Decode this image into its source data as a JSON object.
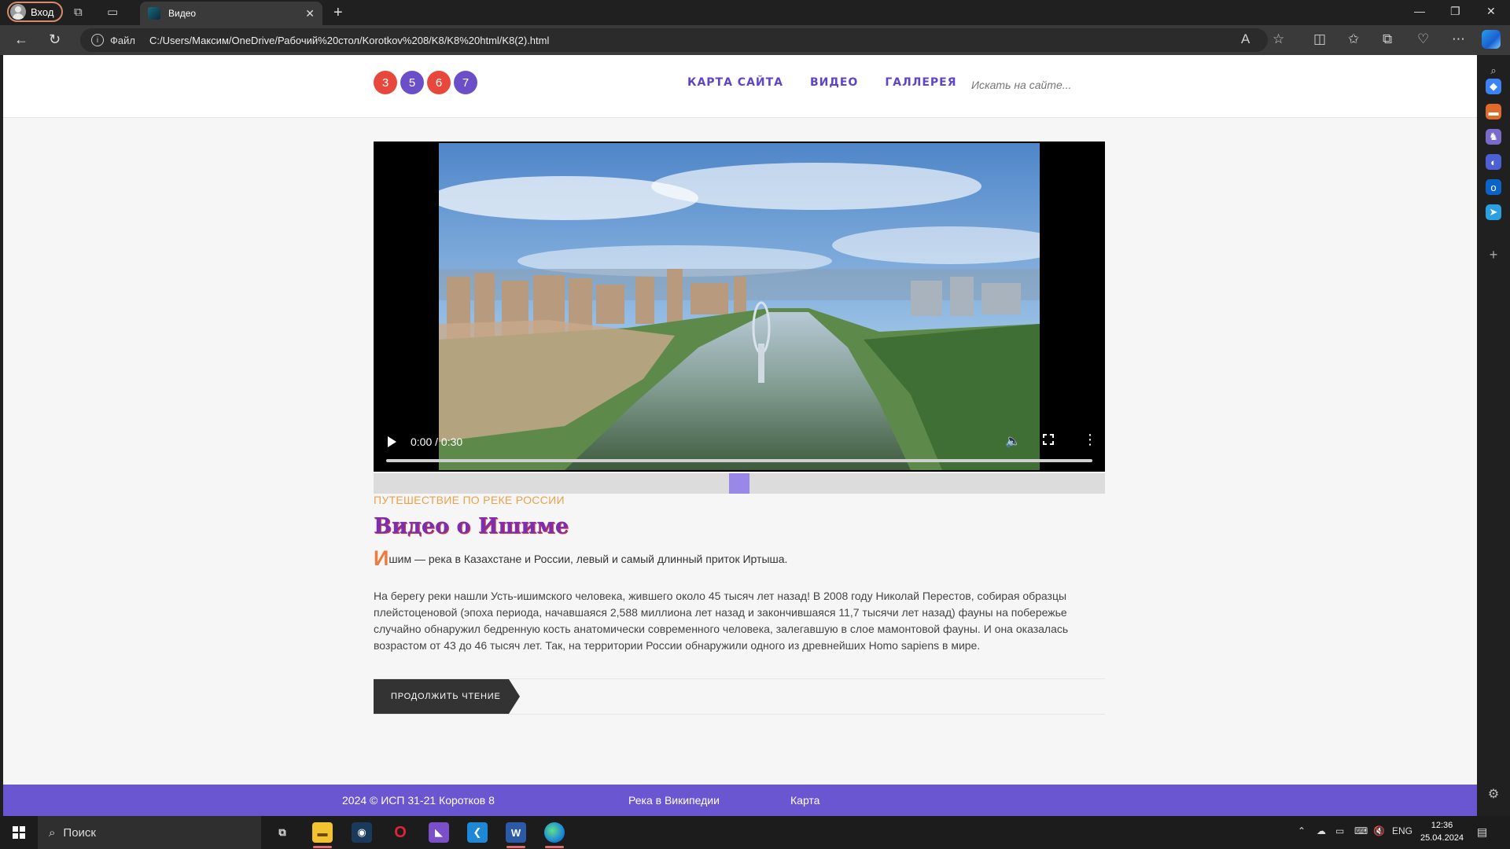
{
  "browser": {
    "profile_label": "Вход",
    "tab_title": "Видео",
    "url_scheme": "Файл",
    "url": "C:/Users/Максим/OneDrive/Рабочий%20стол/Korotkov%208/K8/K8%20html/K8(2).html"
  },
  "site": {
    "logo_digits": [
      "3",
      "5",
      "6",
      "7"
    ],
    "logo_colors": [
      "#e8473c",
      "#6b4fc9",
      "#e8473c",
      "#6b4fc9"
    ],
    "nav": [
      "КАРТА САЙТА",
      "ВИДЕО",
      "ГАЛЛЕРЕЯ"
    ],
    "search_placeholder": "Искать на сайте...",
    "video": {
      "time": "0:00 / 0:30",
      "progress": 0
    },
    "slider_value": 0.5,
    "category": "ПУТЕШЕСТВИЕ ПО РЕКЕ РОССИИ",
    "title": "Видео о Ишиме",
    "lead_dropcap": "И",
    "lead_rest": "шим — река в Казахстане и России, левый и самый длинный приток Иртыша.",
    "body": "На берегу реки нашли Усть-ишимского человека, жившего около 45 тысяч лет назад! В 2008 году Николай Перестов, собирая образцы плейстоценовой (эпоха периода, начавшаяся 2,588 миллиона лет назад и закончившаяся 11,7 тысячи лет назад) фауны на побережье случайно обнаружил бедренную кость анатомически современного человека, залегавшую в слое мамонтовой фауны. И она оказалась возрастом от 43 до 46 тысяч лет. Так, на территории России обнаружили одного из древнейших Homo sapiens в мире.",
    "more_button": "ПРОДОЛЖИТЬ ЧТЕНИЕ",
    "footer": {
      "copyright": "2024 © ИСП 31-21 Коротков 8",
      "wiki_link": "Река в Википедии",
      "map_link": "Карта"
    },
    "accent_color": "#6a56d0"
  },
  "taskbar": {
    "search_label": "Поиск",
    "lang": "ENG",
    "time": "12:36",
    "date": "25.04.2024"
  }
}
